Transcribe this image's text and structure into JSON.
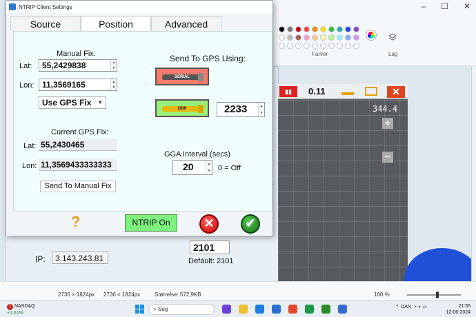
{
  "dialog": {
    "title": "NTRIP Client Settings",
    "tabs": [
      {
        "label": "Source"
      },
      {
        "label": "Position"
      },
      {
        "label": "Advanced"
      }
    ]
  },
  "position": {
    "manual_fix_heading": "Manual Fix:",
    "lat_label": "Lat:",
    "lon_label": "Lon:",
    "manual_lat": "55,2429838",
    "manual_lon": "11,3569165",
    "use_gps_fix": "Use GPS Fix",
    "current_fix_heading": "Current GPS Fix:",
    "current_lat": "55,2430465",
    "current_lon": "11,3569433333333",
    "send_to_manual_button": "Send To Manual Fix",
    "send_to_gps_heading": "Send To GPS Using:",
    "serial_label": "SERIAL",
    "udp_label": "UDP",
    "udp_port": "2233",
    "gga_heading": "GGA Interval (secs)",
    "gga_value": "20",
    "gga_note": "0 = Off"
  },
  "footer": {
    "help_glyph": "?",
    "ntrip_button": "NTRIP On",
    "cancel_glyph": "✕",
    "ok_glyph": "✔"
  },
  "background": {
    "ip_label": "IP:",
    "ip_value": "3.143.243.81",
    "port_value": "2101",
    "default_text": "Default: 2101",
    "farver": "Farver",
    "lag": "Lag",
    "map_speed": "0.11",
    "map_heading": "344.4",
    "status_dim1": "2736 × 1824px",
    "status_dim2": "2736 × 1824px",
    "status_size": "Størrelse: 572,9KB",
    "zoom": "100 %"
  },
  "taskbar": {
    "stock_name": "NASDAQ",
    "stock_change": "+1,61%",
    "badge": "1",
    "search_placeholder": "Søg",
    "lang": "DAN",
    "time": "21:55",
    "date": "12-06-2024"
  },
  "colors": {
    "serial_bg": "#f47a6a",
    "udp_bg": "#98f07a",
    "ntrip_bg": "#7ef07e",
    "content_bg": "#f0fffd"
  }
}
